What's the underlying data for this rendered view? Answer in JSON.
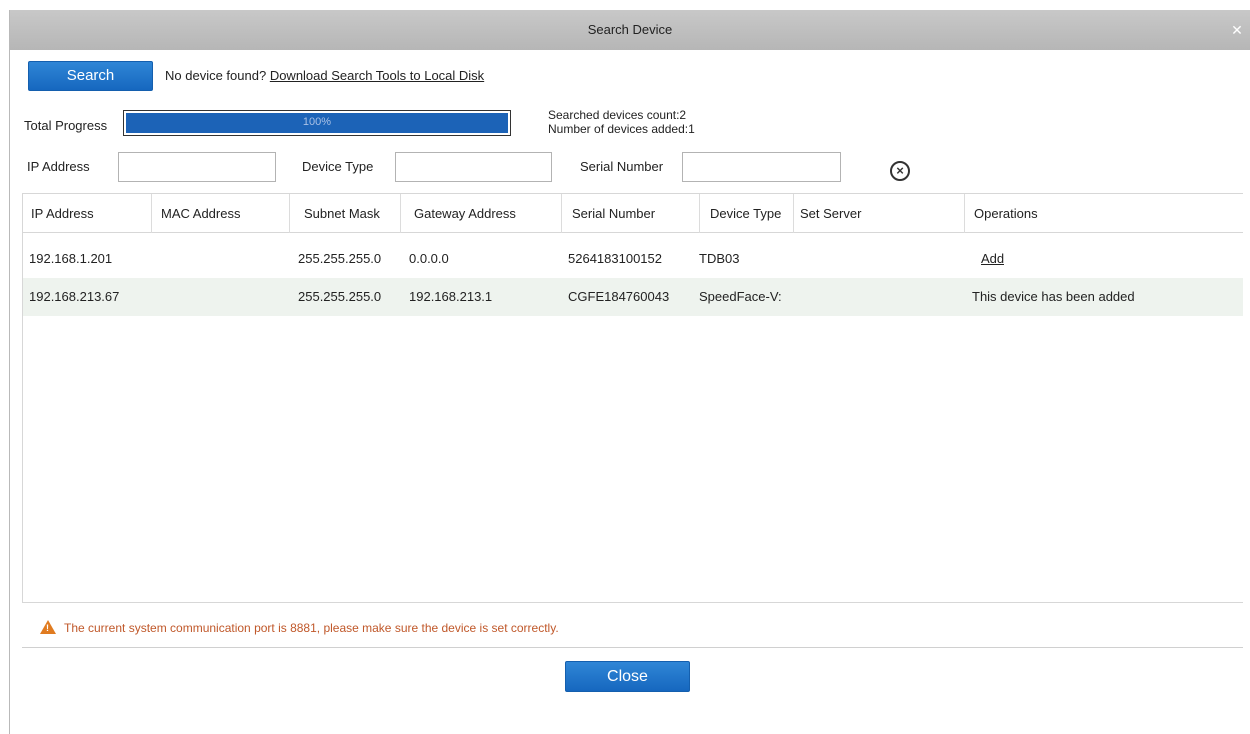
{
  "dialog": {
    "title": "Search Device",
    "close_icon": "close-icon"
  },
  "search": {
    "button_label": "Search",
    "no_device_text": "No device found?",
    "download_link": "Download Search Tools to Local Disk"
  },
  "progress": {
    "label": "Total Progress",
    "value_text": "100%",
    "fraction": 1.0,
    "searched_count": "Searched devices count:2",
    "added_count": "Number of devices added:1"
  },
  "filters": {
    "ip_label": "IP Address",
    "ip_value": "",
    "device_type_label": "Device Type",
    "device_type_value": "",
    "serial_label": "Serial Number",
    "serial_value": "",
    "clear_icon": "clear-circle-icon"
  },
  "table": {
    "columns": [
      "IP Address",
      "MAC Address",
      "Subnet Mask",
      "Gateway Address",
      "Serial Number",
      "Device Type",
      "Set Server",
      "Operations"
    ],
    "rows": [
      {
        "ip": "192.168.1.201",
        "mac": "",
        "subnet": "255.255.255.0",
        "gateway": "0.0.0.0",
        "serial": "5264183100152",
        "type": "TDB03",
        "server": "",
        "operation": "Add"
      },
      {
        "ip": "192.168.213.67",
        "mac": "",
        "subnet": "255.255.255.0",
        "gateway": "192.168.213.1",
        "serial": "CGFE184760043",
        "type": "SpeedFace-V:",
        "server": "",
        "operation": "This device has been added"
      }
    ]
  },
  "footer": {
    "warning_icon": "warning-icon",
    "warning_text": "The current system communication port is 8881, please make sure the device is set correctly.",
    "close_label": "Close"
  },
  "colors": {
    "accent": "#1c63b7",
    "warning": "#c0582a",
    "title_bar": "#bdbdbd"
  }
}
